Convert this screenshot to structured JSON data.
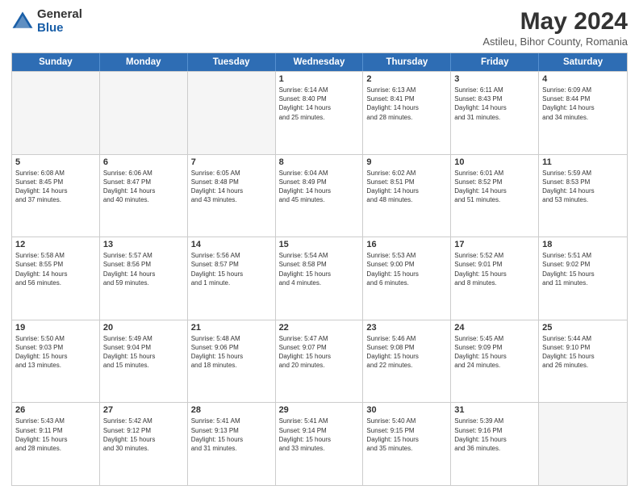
{
  "logo": {
    "general": "General",
    "blue": "Blue"
  },
  "title": "May 2024",
  "subtitle": "Astileu, Bihor County, Romania",
  "weekdays": [
    "Sunday",
    "Monday",
    "Tuesday",
    "Wednesday",
    "Thursday",
    "Friday",
    "Saturday"
  ],
  "weeks": [
    [
      {
        "day": "",
        "info": "",
        "empty": true
      },
      {
        "day": "",
        "info": "",
        "empty": true
      },
      {
        "day": "",
        "info": "",
        "empty": true
      },
      {
        "day": "1",
        "info": "Sunrise: 6:14 AM\nSunset: 8:40 PM\nDaylight: 14 hours\nand 25 minutes."
      },
      {
        "day": "2",
        "info": "Sunrise: 6:13 AM\nSunset: 8:41 PM\nDaylight: 14 hours\nand 28 minutes."
      },
      {
        "day": "3",
        "info": "Sunrise: 6:11 AM\nSunset: 8:43 PM\nDaylight: 14 hours\nand 31 minutes."
      },
      {
        "day": "4",
        "info": "Sunrise: 6:09 AM\nSunset: 8:44 PM\nDaylight: 14 hours\nand 34 minutes."
      }
    ],
    [
      {
        "day": "5",
        "info": "Sunrise: 6:08 AM\nSunset: 8:45 PM\nDaylight: 14 hours\nand 37 minutes."
      },
      {
        "day": "6",
        "info": "Sunrise: 6:06 AM\nSunset: 8:47 PM\nDaylight: 14 hours\nand 40 minutes."
      },
      {
        "day": "7",
        "info": "Sunrise: 6:05 AM\nSunset: 8:48 PM\nDaylight: 14 hours\nand 43 minutes."
      },
      {
        "day": "8",
        "info": "Sunrise: 6:04 AM\nSunset: 8:49 PM\nDaylight: 14 hours\nand 45 minutes."
      },
      {
        "day": "9",
        "info": "Sunrise: 6:02 AM\nSunset: 8:51 PM\nDaylight: 14 hours\nand 48 minutes."
      },
      {
        "day": "10",
        "info": "Sunrise: 6:01 AM\nSunset: 8:52 PM\nDaylight: 14 hours\nand 51 minutes."
      },
      {
        "day": "11",
        "info": "Sunrise: 5:59 AM\nSunset: 8:53 PM\nDaylight: 14 hours\nand 53 minutes."
      }
    ],
    [
      {
        "day": "12",
        "info": "Sunrise: 5:58 AM\nSunset: 8:55 PM\nDaylight: 14 hours\nand 56 minutes."
      },
      {
        "day": "13",
        "info": "Sunrise: 5:57 AM\nSunset: 8:56 PM\nDaylight: 14 hours\nand 59 minutes."
      },
      {
        "day": "14",
        "info": "Sunrise: 5:56 AM\nSunset: 8:57 PM\nDaylight: 15 hours\nand 1 minute."
      },
      {
        "day": "15",
        "info": "Sunrise: 5:54 AM\nSunset: 8:58 PM\nDaylight: 15 hours\nand 4 minutes."
      },
      {
        "day": "16",
        "info": "Sunrise: 5:53 AM\nSunset: 9:00 PM\nDaylight: 15 hours\nand 6 minutes."
      },
      {
        "day": "17",
        "info": "Sunrise: 5:52 AM\nSunset: 9:01 PM\nDaylight: 15 hours\nand 8 minutes."
      },
      {
        "day": "18",
        "info": "Sunrise: 5:51 AM\nSunset: 9:02 PM\nDaylight: 15 hours\nand 11 minutes."
      }
    ],
    [
      {
        "day": "19",
        "info": "Sunrise: 5:50 AM\nSunset: 9:03 PM\nDaylight: 15 hours\nand 13 minutes."
      },
      {
        "day": "20",
        "info": "Sunrise: 5:49 AM\nSunset: 9:04 PM\nDaylight: 15 hours\nand 15 minutes."
      },
      {
        "day": "21",
        "info": "Sunrise: 5:48 AM\nSunset: 9:06 PM\nDaylight: 15 hours\nand 18 minutes."
      },
      {
        "day": "22",
        "info": "Sunrise: 5:47 AM\nSunset: 9:07 PM\nDaylight: 15 hours\nand 20 minutes."
      },
      {
        "day": "23",
        "info": "Sunrise: 5:46 AM\nSunset: 9:08 PM\nDaylight: 15 hours\nand 22 minutes."
      },
      {
        "day": "24",
        "info": "Sunrise: 5:45 AM\nSunset: 9:09 PM\nDaylight: 15 hours\nand 24 minutes."
      },
      {
        "day": "25",
        "info": "Sunrise: 5:44 AM\nSunset: 9:10 PM\nDaylight: 15 hours\nand 26 minutes."
      }
    ],
    [
      {
        "day": "26",
        "info": "Sunrise: 5:43 AM\nSunset: 9:11 PM\nDaylight: 15 hours\nand 28 minutes."
      },
      {
        "day": "27",
        "info": "Sunrise: 5:42 AM\nSunset: 9:12 PM\nDaylight: 15 hours\nand 30 minutes."
      },
      {
        "day": "28",
        "info": "Sunrise: 5:41 AM\nSunset: 9:13 PM\nDaylight: 15 hours\nand 31 minutes."
      },
      {
        "day": "29",
        "info": "Sunrise: 5:41 AM\nSunset: 9:14 PM\nDaylight: 15 hours\nand 33 minutes."
      },
      {
        "day": "30",
        "info": "Sunrise: 5:40 AM\nSunset: 9:15 PM\nDaylight: 15 hours\nand 35 minutes."
      },
      {
        "day": "31",
        "info": "Sunrise: 5:39 AM\nSunset: 9:16 PM\nDaylight: 15 hours\nand 36 minutes."
      },
      {
        "day": "",
        "info": "",
        "empty": true
      }
    ]
  ]
}
